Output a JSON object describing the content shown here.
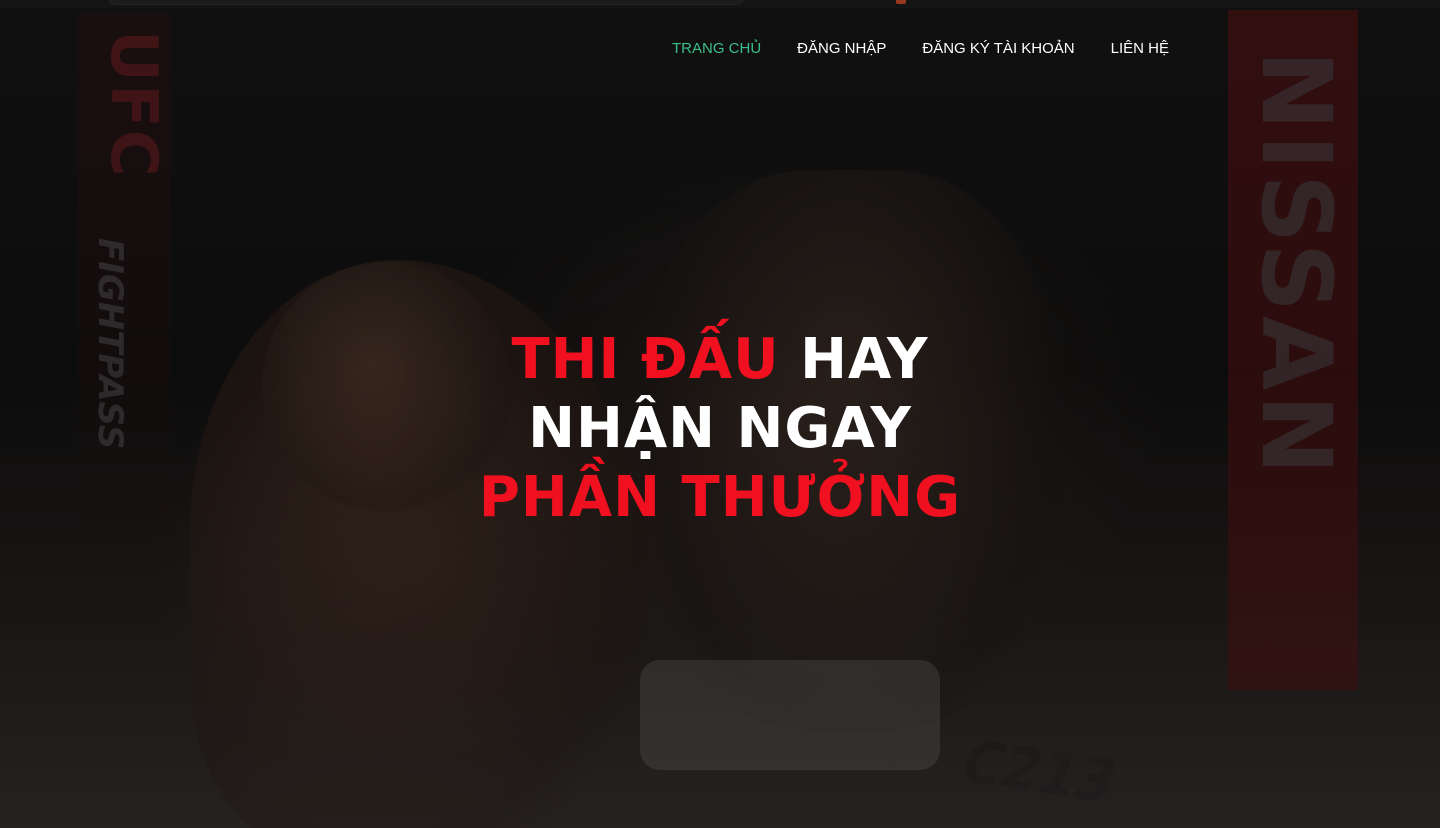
{
  "nav": {
    "items": [
      {
        "label": "TRANG CHỦ",
        "active": true
      },
      {
        "label": "ĐĂNG NHẬP",
        "active": false
      },
      {
        "label": "ĐĂNG KÝ TÀI KHOẢN",
        "active": false
      },
      {
        "label": "LIÊN HỆ",
        "active": false
      }
    ]
  },
  "hero": {
    "line1_red": "THI ĐẤU",
    "line1_white": "HAY",
    "line2_white": "NHẬN NGAY",
    "line3_red": "PHẦN THƯỞNG"
  },
  "background": {
    "banner_left_brand": "UFC",
    "banner_left_sub": "FIGHTPASS",
    "banner_right_brand": "NISSAN",
    "floor_mark": "C213"
  },
  "colors": {
    "accent_red": "#f1101f",
    "nav_active": "#3bbf8a",
    "nav_text": "#ffffff"
  }
}
